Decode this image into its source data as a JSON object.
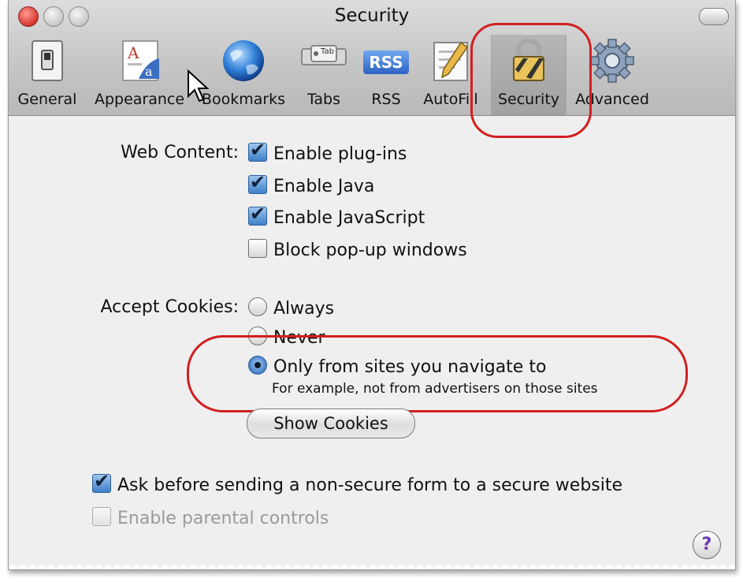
{
  "window": {
    "title": "Security",
    "colors": {
      "highlight_ring": "#d21f1f",
      "accent": "#3f7fc8"
    }
  },
  "toolbar": {
    "items": [
      {
        "label": "General",
        "icon": "light-switch-icon"
      },
      {
        "label": "Appearance",
        "icon": "fonts-icon"
      },
      {
        "label": "Bookmarks",
        "icon": "globe-icon"
      },
      {
        "label": "Tabs",
        "icon": "tabs-icon"
      },
      {
        "label": "RSS",
        "icon": "rss-icon",
        "badge": "RSS"
      },
      {
        "label": "AutoFill",
        "icon": "pencil-form-icon"
      },
      {
        "label": "Security",
        "icon": "padlock-icon",
        "selected": true
      },
      {
        "label": "Advanced",
        "icon": "gear-icon"
      }
    ],
    "tabs_badge": "Tab"
  },
  "web_content": {
    "label": "Web Content:",
    "options": [
      {
        "label": "Enable plug-ins",
        "checked": true
      },
      {
        "label": "Enable Java",
        "checked": true
      },
      {
        "label": "Enable JavaScript",
        "checked": true
      },
      {
        "label": "Block pop-up windows",
        "checked": false
      }
    ]
  },
  "cookies": {
    "label": "Accept Cookies:",
    "options": [
      {
        "label": "Always",
        "selected": false
      },
      {
        "label": "Never",
        "selected": false
      },
      {
        "label": "Only from sites you navigate to",
        "selected": true
      }
    ],
    "hint": "For example, not from advertisers on those sites",
    "show_button": "Show Cookies"
  },
  "form_warning": {
    "label": "Ask before sending a non-secure form to a secure website",
    "checked": true
  },
  "parental": {
    "label": "Enable parental controls",
    "checked": false,
    "enabled": false
  },
  "help": {
    "glyph": "?"
  }
}
